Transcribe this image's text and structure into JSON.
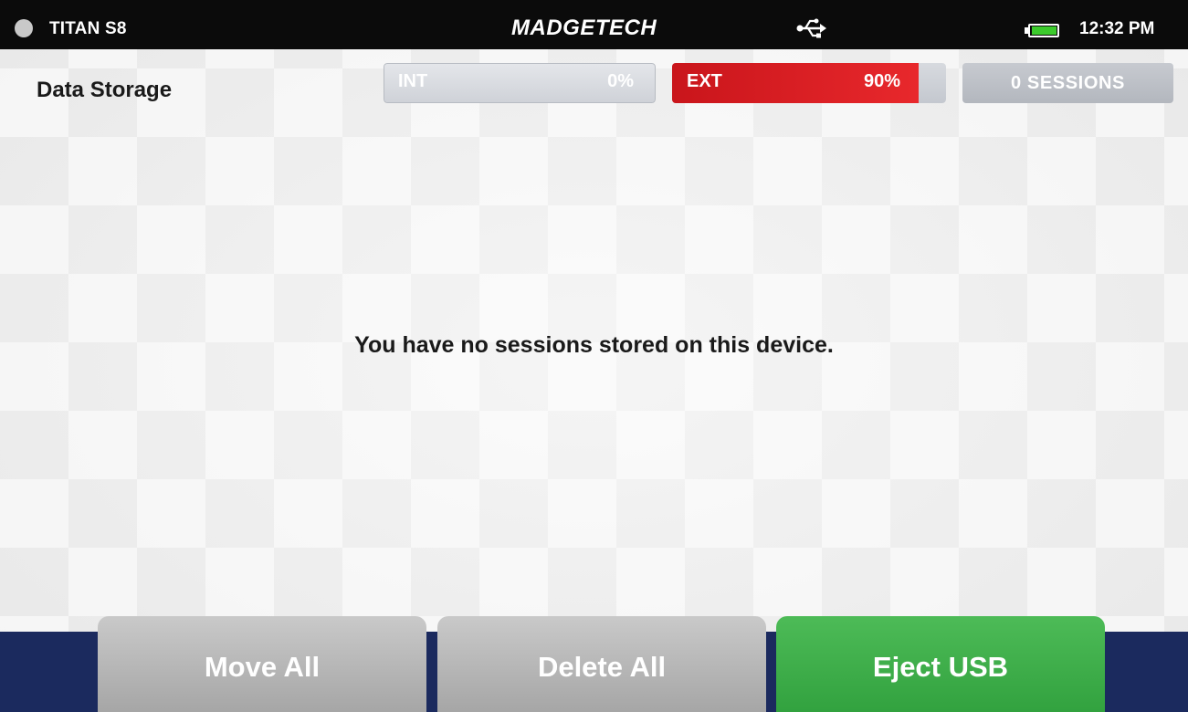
{
  "status_bar": {
    "device_name": "TITAN S8",
    "brand": "MADGETECH",
    "time": "12:32 PM",
    "usb_icon": "usb-icon",
    "battery_icon": "battery-icon",
    "battery_level": 1.0,
    "battery_color": "#3ccb2c",
    "indicator_color": "#c9c9c9"
  },
  "header": {
    "title": "Data Storage",
    "internal": {
      "label": "INT",
      "percent_text": "0%",
      "level": 0.0
    },
    "external": {
      "label": "EXT",
      "percent_text": "90%",
      "level": 0.9,
      "color": "#e8282c"
    },
    "sessions": "0 SESSIONS"
  },
  "main": {
    "empty_message": "You have no sessions stored on this device."
  },
  "actions": {
    "move_all": "Move All",
    "delete_all": "Delete All",
    "eject_usb": "Eject USB",
    "eject_color": "#3fae4a"
  }
}
